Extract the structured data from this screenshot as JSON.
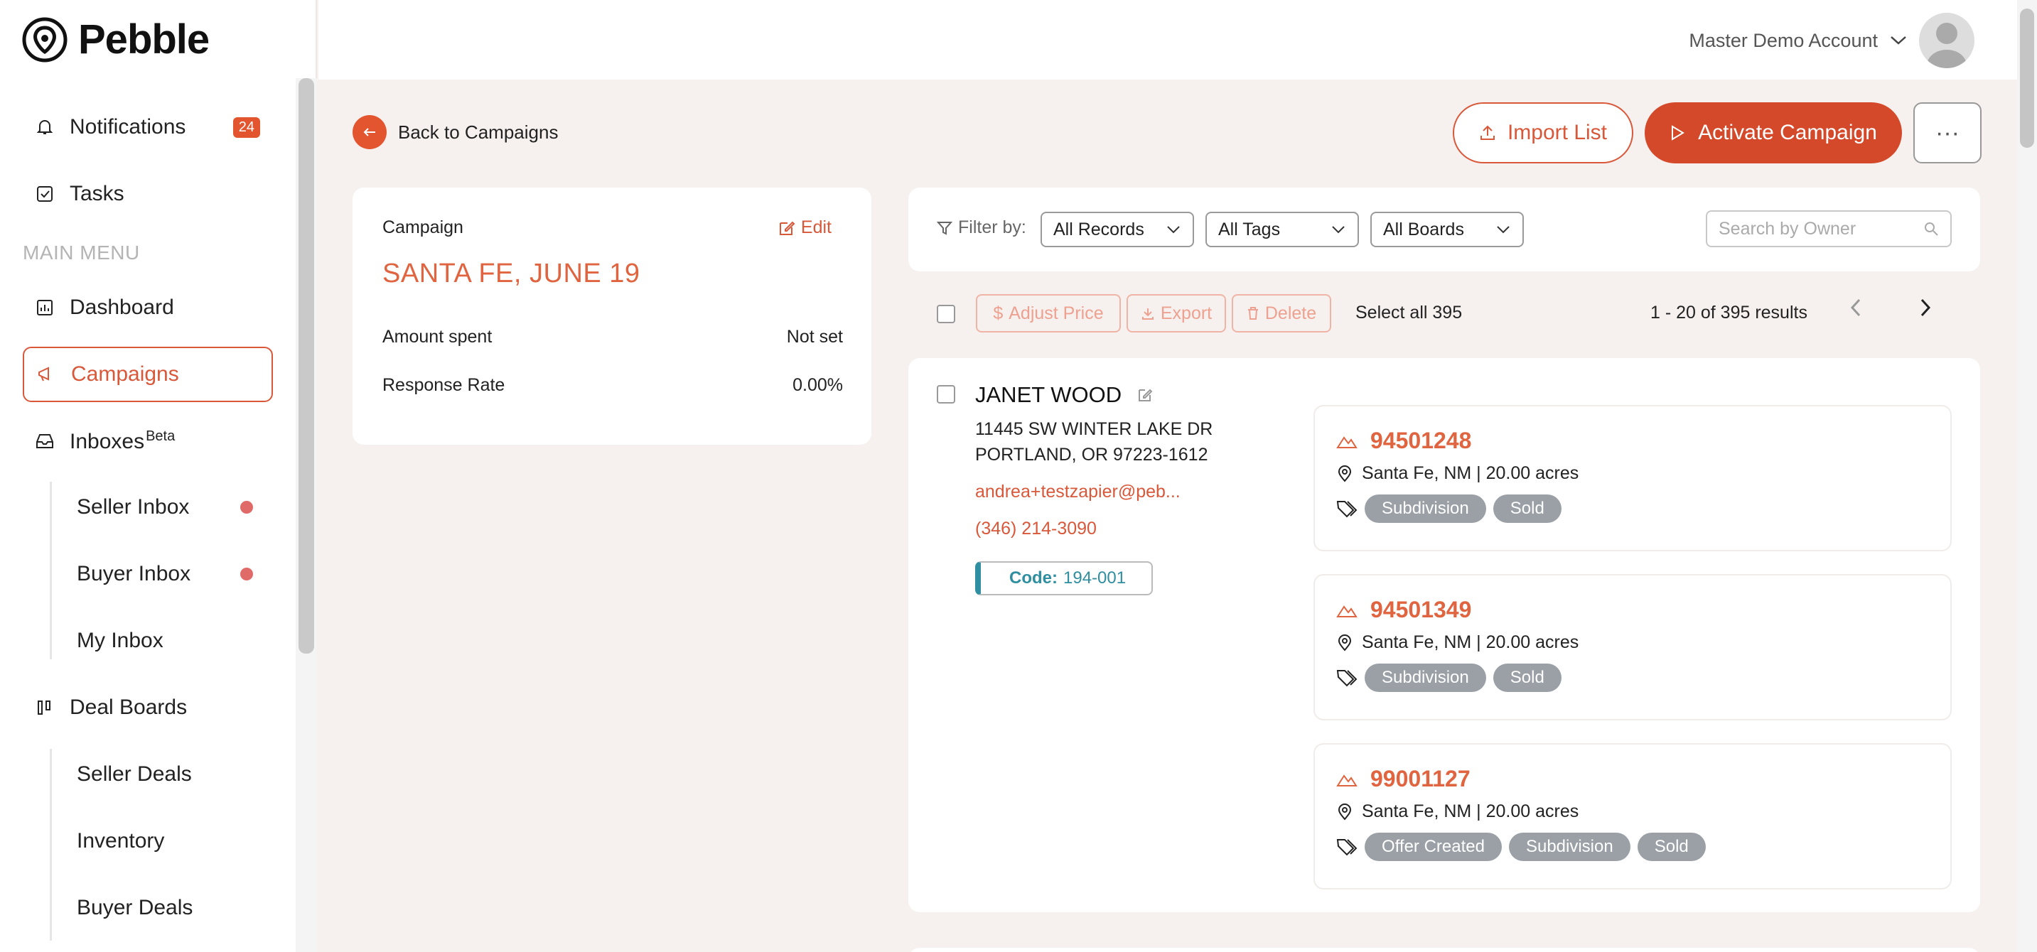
{
  "app": {
    "name": "Pebble"
  },
  "sidebar": {
    "notifications": {
      "label": "Notifications",
      "count": "24"
    },
    "tasks": {
      "label": "Tasks"
    },
    "section": "MAIN MENU",
    "dashboard": "Dashboard",
    "campaigns": "Campaigns",
    "inboxes": {
      "label": "Inboxes",
      "badge": "Beta"
    },
    "inbox_items": [
      "Seller Inbox",
      "Buyer Inbox",
      "My Inbox"
    ],
    "deal_boards": "Deal Boards",
    "deal_items": [
      "Seller Deals",
      "Inventory",
      "Buyer Deals"
    ]
  },
  "header": {
    "account": "Master Demo Account"
  },
  "actions": {
    "back": "Back to Campaigns",
    "import": "Import List",
    "activate": "Activate Campaign",
    "more": "···"
  },
  "campaign": {
    "label": "Campaign",
    "edit": "Edit",
    "name": "SANTA FE, JUNE 19",
    "amount_label": "Amount spent",
    "amount_value": "Not set",
    "response_label": "Response Rate",
    "response_value": "0.00%"
  },
  "filters": {
    "label": "Filter by:",
    "records": "All Records",
    "tags": "All Tags",
    "boards": "All Boards",
    "search_placeholder": "Search by Owner"
  },
  "toolbar": {
    "adjust": "Adjust Price",
    "export": "Export",
    "delete": "Delete",
    "select_all": "Select all 395",
    "results": "1 - 20 of 395 results"
  },
  "record": {
    "owner": "JANET WOOD",
    "address1": "11445 SW WINTER LAKE DR",
    "address2": "PORTLAND, OR 97223-1612",
    "email": "andrea+testzapier@peb...",
    "phone": "(346) 214-3090",
    "code_label": "Code:",
    "code_value": "194-001",
    "properties": [
      {
        "id": "94501248",
        "location": "Santa Fe, NM | 20.00 acres",
        "tags": [
          "Subdivision",
          "Sold"
        ]
      },
      {
        "id": "94501349",
        "location": "Santa Fe, NM | 20.00 acres",
        "tags": [
          "Subdivision",
          "Sold"
        ]
      },
      {
        "id": "99001127",
        "location": "Santa Fe, NM | 20.00 acres",
        "tags": [
          "Offer Created",
          "Subdivision",
          "Sold"
        ]
      }
    ]
  },
  "colors": {
    "accent": "#d9583a",
    "primary": "#d5492b",
    "teal": "#2f8fa0",
    "tag": "#9aa0a6",
    "background": "#f6f1ee"
  }
}
